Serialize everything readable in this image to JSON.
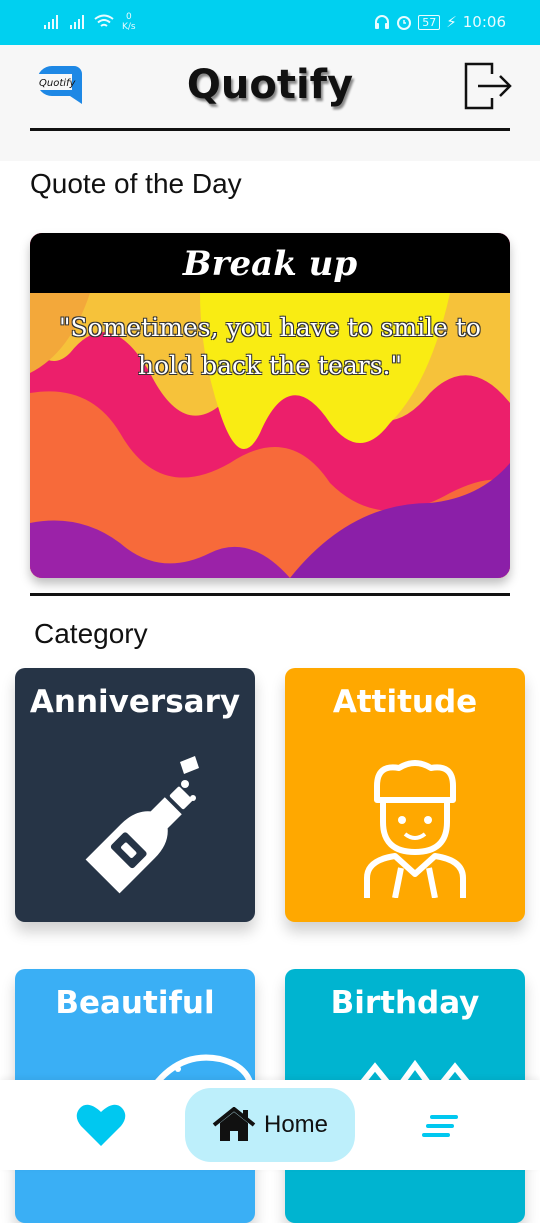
{
  "status_bar": {
    "net_speed_value": "0",
    "net_speed_unit": "K/s",
    "battery": "57",
    "time": "10:06"
  },
  "header": {
    "app_title": "Quotify",
    "logo_text": "Quotify"
  },
  "quote_of_the_day": {
    "section_title": "Quote of the Day",
    "category": "Break up",
    "text": "\"Sometimes, you have to smile to hold back the tears.\""
  },
  "categories": {
    "section_title": "Category",
    "items": [
      {
        "label": "Anniversary",
        "color": "#263446",
        "icon": "champagne-bottle-icon"
      },
      {
        "label": "Attitude",
        "color": "#ffa800",
        "icon": "chef-person-icon"
      },
      {
        "label": "Beautiful",
        "color": "#3aaff5",
        "icon": "face-icon"
      },
      {
        "label": "Birthday",
        "color": "#00b4d0",
        "icon": "crown-icon"
      }
    ]
  },
  "bottom_nav": {
    "home_label": "Home"
  },
  "colors": {
    "status_bar": "#00d0f0",
    "accent": "#00c8f0",
    "home_pill": "#bdeffb"
  }
}
